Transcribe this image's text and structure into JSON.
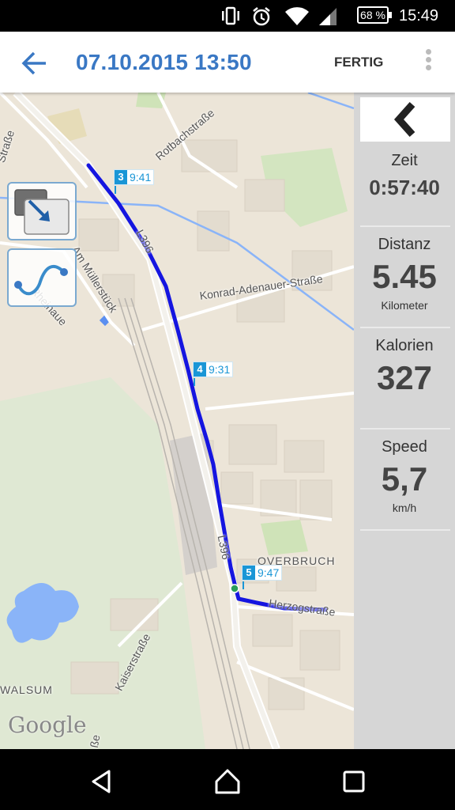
{
  "status_bar": {
    "battery": "68 %",
    "time": "15:49",
    "icons": [
      "vibrate-icon",
      "alarm-icon",
      "wifi-icon",
      "cell-signal-icon",
      "battery-icon"
    ]
  },
  "app_bar": {
    "title": "07.10.2015 13:50",
    "done_label": "FERTIG",
    "accent_color": "#3a78c4"
  },
  "map": {
    "labels": {
      "street_top_left": "Straße",
      "rotbach": "Rotbachstraße",
      "l396_top": "L396",
      "am_muellerstueck": "Am Müllerstück",
      "rheinaue": "Rheinaue",
      "konrad": "Konrad-Adenauer-Straße",
      "l396_bottom": "L396",
      "overbruch": "OVERBRUCH",
      "herzog": "Herzogstraße",
      "kaiser": "Kaiserstraße",
      "walsum": "WALSUM",
      "bottom_road": "ße"
    },
    "markers": [
      {
        "num": "3",
        "time": "9:41"
      },
      {
        "num": "4",
        "time": "9:31"
      },
      {
        "num": "5",
        "time": "9:47"
      }
    ],
    "google_logo": "Google",
    "route_color": "#1515e0"
  },
  "stats": {
    "time": {
      "label": "Zeit",
      "value": "0:57:40"
    },
    "distance": {
      "label": "Distanz",
      "value": "5.45",
      "unit": "Kilometer"
    },
    "calories": {
      "label": "Kalorien",
      "value": "327"
    },
    "speed": {
      "label": "Speed",
      "value": "5,7",
      "unit": "km/h"
    }
  },
  "nav_bar": {
    "icons": [
      "back-triangle-icon",
      "home-circle-icon",
      "recents-square-icon"
    ]
  }
}
